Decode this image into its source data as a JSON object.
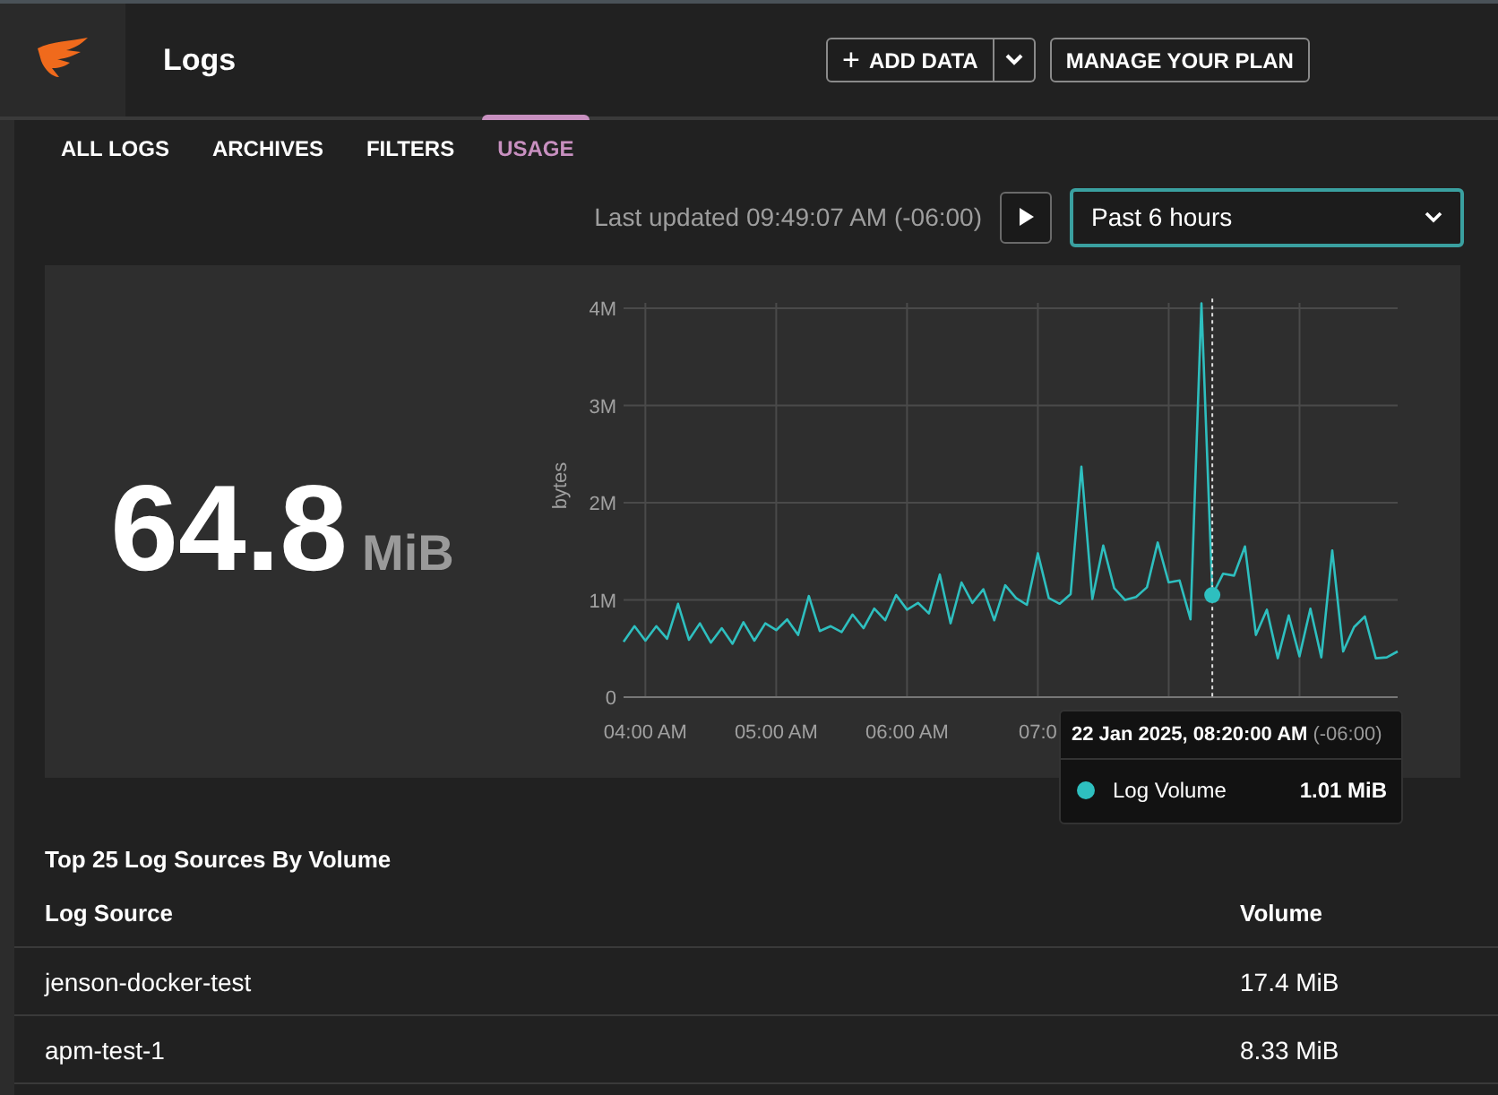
{
  "header": {
    "title": "Logs",
    "add_button": {
      "icon": "+",
      "label": "ADD DATA"
    },
    "plan_button": "MANAGE YOUR PLAN"
  },
  "tabs": [
    {
      "label": "ALL LOGS",
      "selected": false
    },
    {
      "label": "ARCHIVES",
      "selected": false
    },
    {
      "label": "FILTERS",
      "selected": false
    },
    {
      "label": "USAGE",
      "selected": true
    }
  ],
  "toolbar": {
    "last_updated": "Last updated 09:49:07 AM (-06:00)",
    "time_range": "Past 6 hours"
  },
  "summary": {
    "value": "64.8",
    "unit": "MiB"
  },
  "usage_chart": {
    "chart_data": {
      "type": "line",
      "ylabel": "bytes",
      "xlim": [
        230,
        585
      ],
      "ylim": [
        0,
        4.1
      ],
      "x": [
        230,
        235,
        240,
        245,
        250,
        255,
        260,
        265,
        270,
        275,
        280,
        285,
        290,
        295,
        300,
        305,
        310,
        315,
        320,
        325,
        330,
        335,
        340,
        345,
        350,
        355,
        360,
        365,
        370,
        375,
        380,
        385,
        390,
        395,
        400,
        405,
        410,
        415,
        420,
        425,
        430,
        435,
        440,
        445,
        450,
        455,
        460,
        465,
        470,
        475,
        480,
        485,
        490,
        495,
        500,
        505,
        510,
        515,
        520,
        525,
        530,
        535,
        540,
        545,
        550,
        555,
        560,
        565,
        570,
        575,
        580,
        585
      ],
      "series": [
        {
          "name": "Log Volume",
          "color": "#2ebfbf",
          "values": [
            0.57,
            0.73,
            0.58,
            0.73,
            0.6,
            0.96,
            0.59,
            0.76,
            0.56,
            0.71,
            0.55,
            0.77,
            0.58,
            0.76,
            0.69,
            0.8,
            0.64,
            1.04,
            0.68,
            0.73,
            0.67,
            0.85,
            0.71,
            0.91,
            0.79,
            1.05,
            0.9,
            0.97,
            0.86,
            1.26,
            0.76,
            1.18,
            0.97,
            1.11,
            0.79,
            1.15,
            1.02,
            0.95,
            1.48,
            1.02,
            0.96,
            1.06,
            2.37,
            1.01,
            1.56,
            1.12,
            1.0,
            1.03,
            1.13,
            1.59,
            1.18,
            1.2,
            0.8,
            4.05,
            1.05,
            1.27,
            1.25,
            1.55,
            0.64,
            0.9,
            0.4,
            0.84,
            0.42,
            0.91,
            0.41,
            1.51,
            0.47,
            0.72,
            0.83,
            0.4,
            0.41,
            0.47
          ]
        }
      ],
      "xticks": [
        {
          "value": 240,
          "label": "04:00 AM"
        },
        {
          "value": 300,
          "label": "05:00 AM"
        },
        {
          "value": 360,
          "label": "06:00 AM"
        },
        {
          "value": 420,
          "label": "07:0"
        }
      ],
      "yticks": [
        {
          "value": 0,
          "label": "0"
        },
        {
          "value": 1,
          "label": "1M"
        },
        {
          "value": 2,
          "label": "2M"
        },
        {
          "value": 3,
          "label": "3M"
        },
        {
          "value": 4,
          "label": "4M"
        }
      ],
      "grid": true,
      "ref_lines": [
        {
          "axis": "x",
          "value": 500
        }
      ]
    },
    "tooltip": {
      "date": "22 Jan 2025, 08:20:00 AM",
      "timezone": "(-06:00)",
      "value": "1.01 MiB"
    }
  },
  "sources": {
    "title": "Top 25 Log Sources By Volume",
    "columns": [
      "Log Source",
      "Volume"
    ],
    "rows": [
      {
        "source": "jenson-docker-test",
        "volume": "17.4 MiB"
      },
      {
        "source": "apm-test-1",
        "volume": "8.33 MiB"
      }
    ]
  }
}
